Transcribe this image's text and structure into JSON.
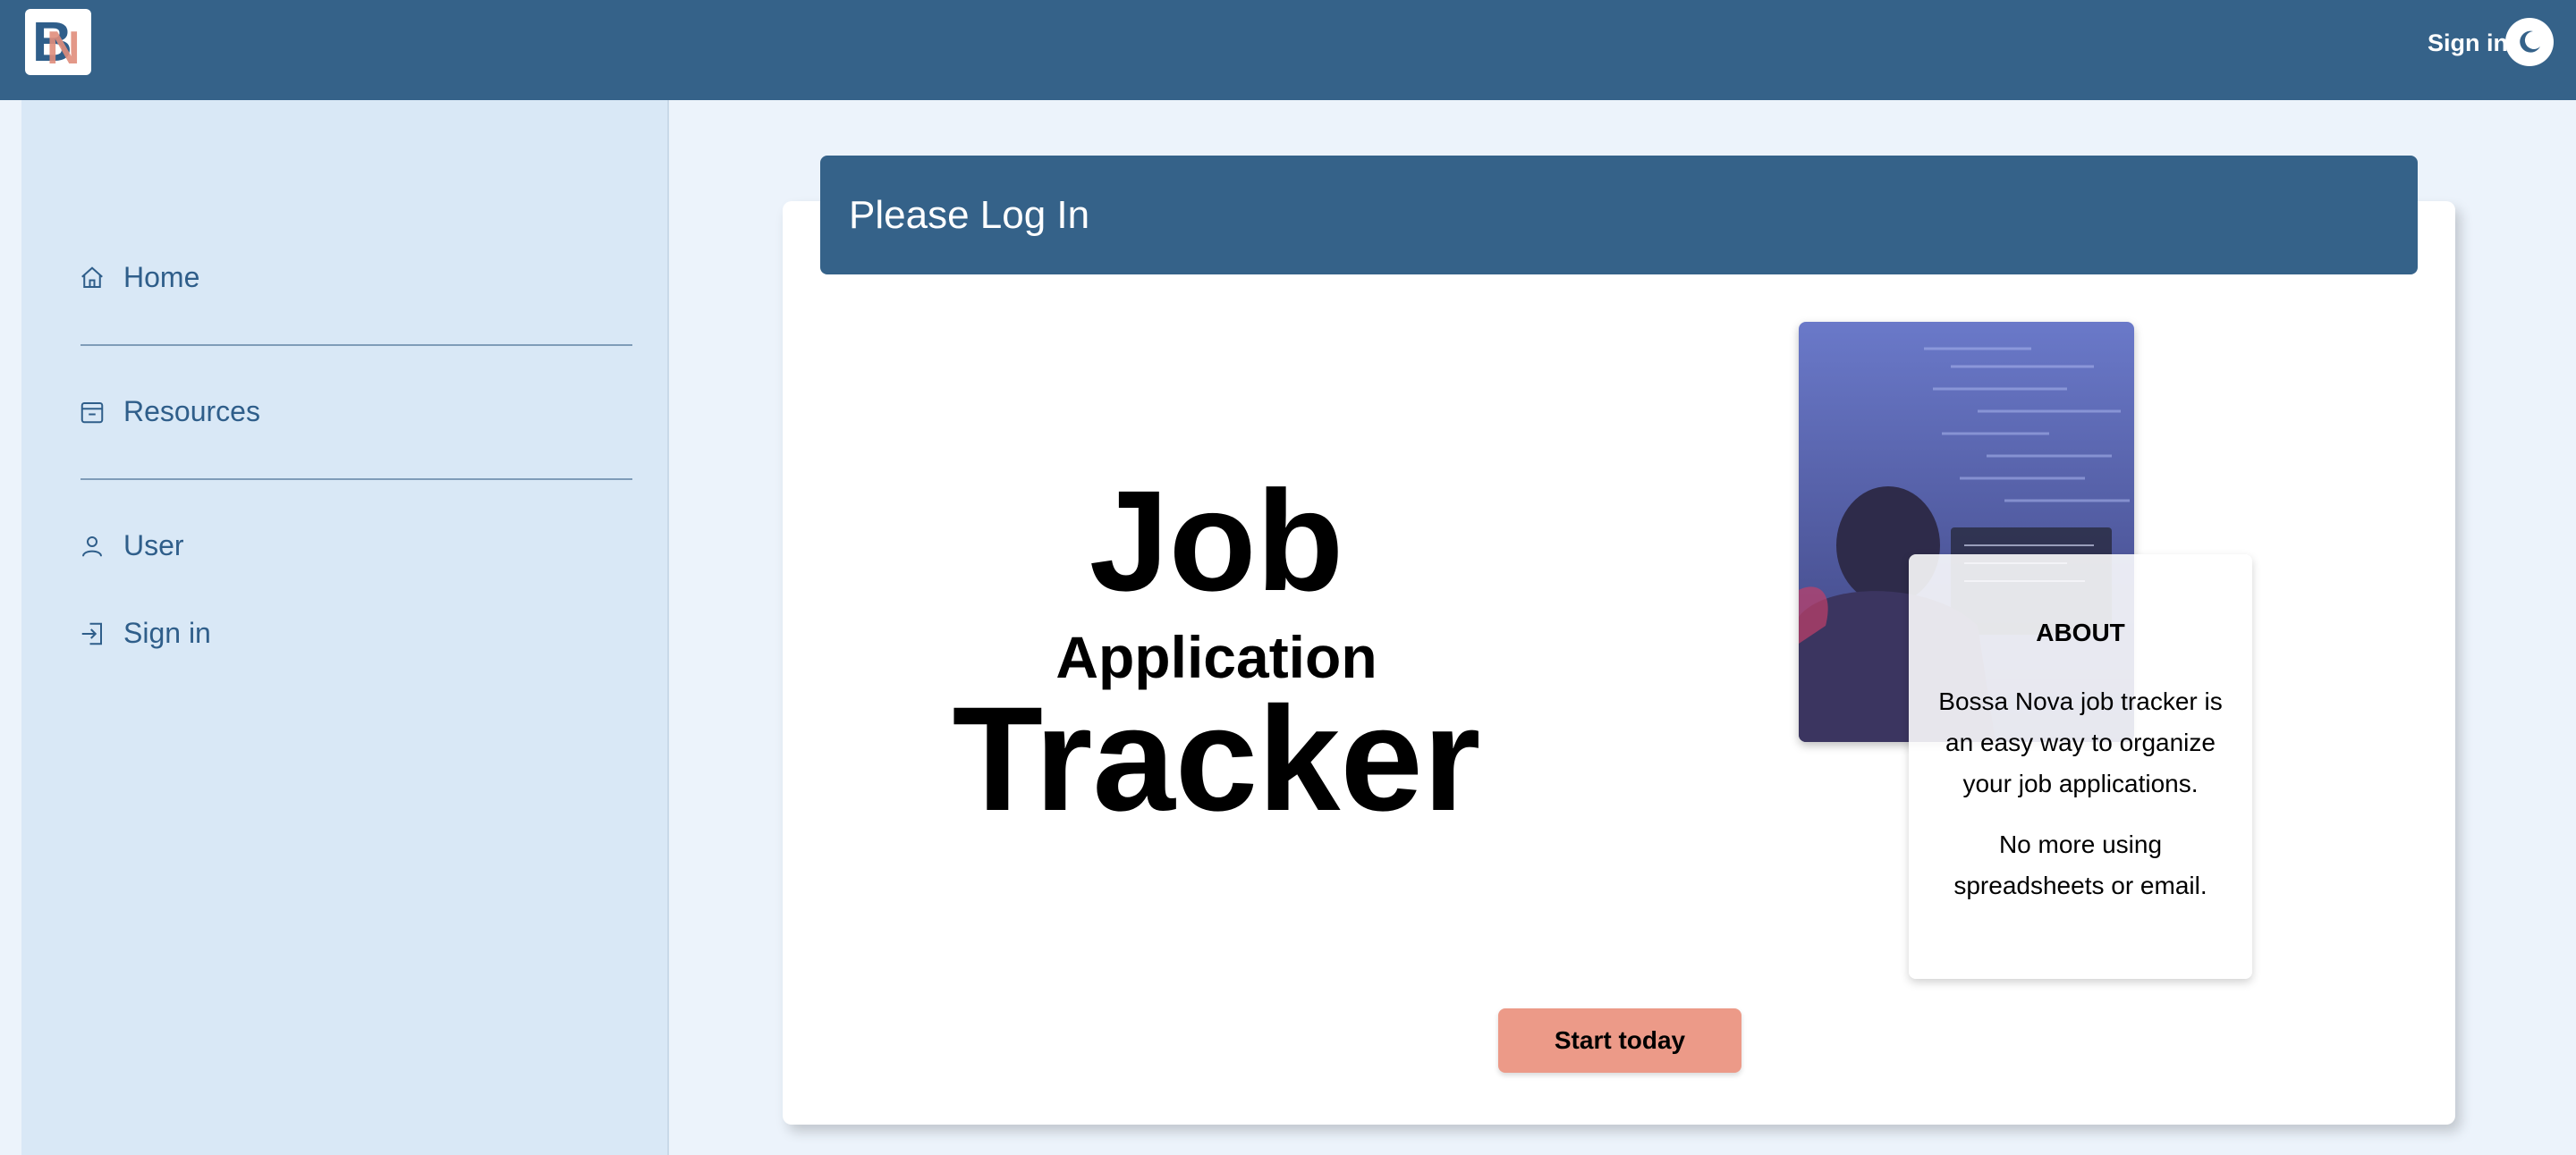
{
  "app": {
    "logo_text": "BN"
  },
  "topbar": {
    "signin_label": "Sign in",
    "theme_icon": "moon-icon"
  },
  "sidebar": {
    "items": [
      {
        "label": "Home",
        "icon": "home-icon"
      },
      {
        "label": "Resources",
        "icon": "calendar-icon"
      },
      {
        "label": "User",
        "icon": "user-icon"
      },
      {
        "label": "Sign in",
        "icon": "sign-in-icon"
      }
    ]
  },
  "main": {
    "header_title": "Please Log In",
    "hero": {
      "line1": "Job",
      "line2": "Application",
      "line3": "Tracker"
    },
    "about": {
      "title": "ABOUT",
      "p1": "Bossa Nova job tracker is an easy way to organize your job applications.",
      "p2": "No more using spreadsheets or email."
    },
    "cta_label": "Start today"
  },
  "colors": {
    "primary": "#356289",
    "sidebar_bg": "#d9e8f6",
    "page_bg": "#ecf3fb",
    "cta": "#ec9a88"
  }
}
